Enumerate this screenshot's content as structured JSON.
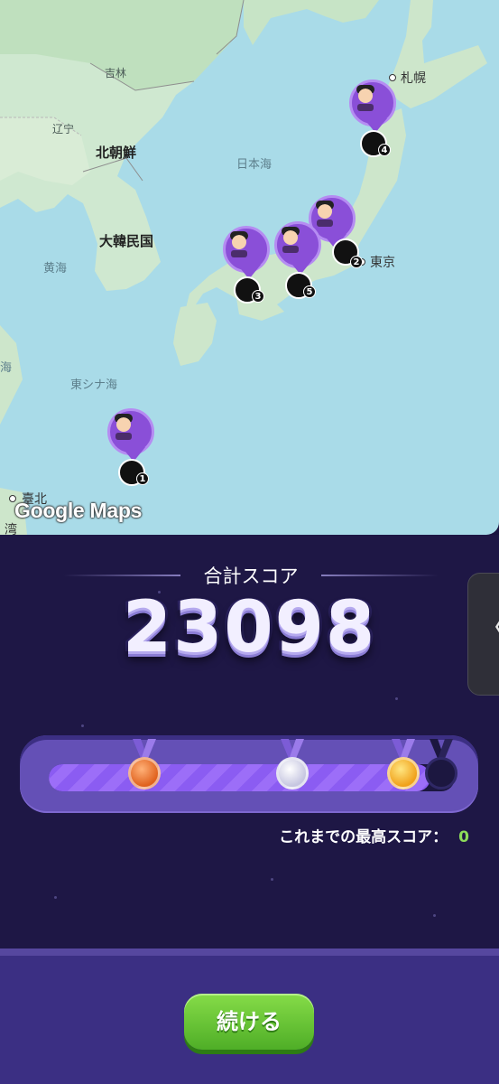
{
  "map": {
    "attribution": "Google Maps",
    "labels": {
      "jilin": "吉林",
      "liaoning": "辽宁",
      "north_korea": "北朝鮮",
      "south_korea": "大韓民国",
      "yellow_sea": "黄海",
      "sea_of_japan": "日本海",
      "east_china_sea": "東シナ海",
      "sapporo": "札幌",
      "tokyo": "東京",
      "taipei": "臺北",
      "taiwan_partial": "湾",
      "left_edge_partial": "海"
    },
    "pins": [
      {
        "number": "1",
        "icon": "avatar-pin-icon"
      },
      {
        "number": "2",
        "icon": "avatar-pin-icon"
      },
      {
        "number": "3",
        "icon": "avatar-pin-icon"
      },
      {
        "number": "4",
        "icon": "avatar-pin-icon"
      },
      {
        "number": "5",
        "icon": "avatar-pin-icon"
      }
    ]
  },
  "score": {
    "title": "合計スコア",
    "total": "23098",
    "best_label": "これまでの最高スコア：",
    "best_value": "0",
    "progress_fraction": 0.94,
    "medals": [
      "bronze-medal-icon",
      "silver-medal-icon",
      "gold-medal-icon",
      "locked-medal-icon"
    ]
  },
  "side_tab": {
    "icon": "chevron-left-icon",
    "glyph": "〈"
  },
  "footer": {
    "continue_label": "続ける"
  },
  "colors": {
    "panel_bg": "#1e1745",
    "accent_purple": "#8a4fd8",
    "continue_green": "#5fbf30",
    "best_value": "#8ddc5a"
  }
}
